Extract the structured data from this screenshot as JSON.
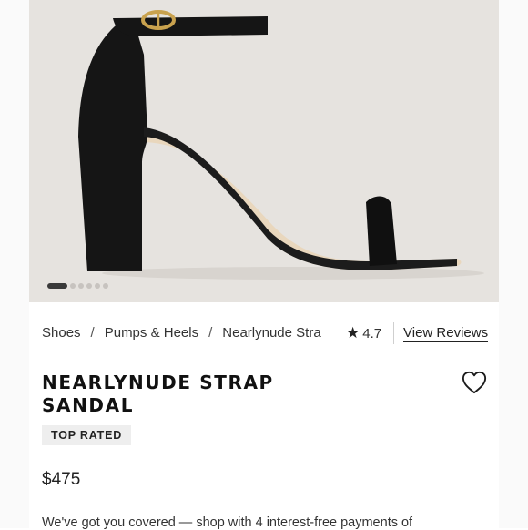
{
  "product_image": {
    "alt": "Black block-heel ankle strap sandal",
    "carousel": {
      "total_slides": 6,
      "active_index": 0
    }
  },
  "breadcrumb": {
    "items": [
      "Shoes",
      "Pumps & Heels",
      "Nearlynude Stra"
    ],
    "separator": "/"
  },
  "rating": {
    "star_icon": "star-icon",
    "value": "4.7"
  },
  "reviews_link": {
    "label": "View Reviews"
  },
  "product": {
    "title": "NEARLYNUDE STRAP SANDAL",
    "badge": "TOP RATED",
    "price": "$475",
    "promo_text": "We've got you covered — shop with 4 interest-free payments of"
  },
  "wishlist": {
    "icon": "heart-icon"
  },
  "colors": {
    "hero_bg": "#e6e3df",
    "shoe": "#151515",
    "sole": "#e9d7bd",
    "buckle": "#c9a24e",
    "text": "#1a1a1a"
  }
}
